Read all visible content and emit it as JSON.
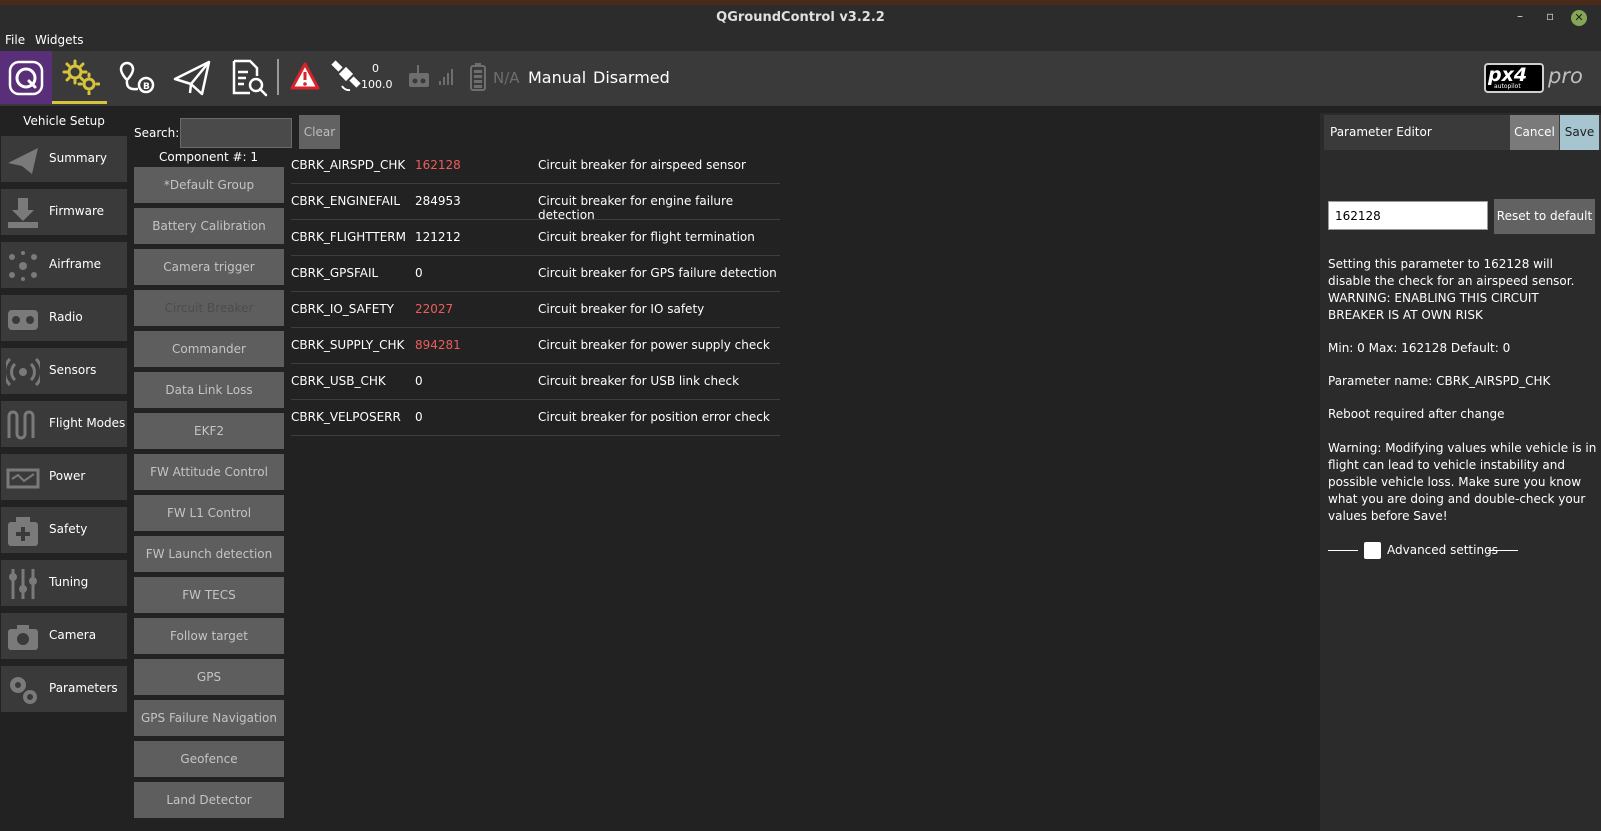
{
  "window": {
    "title": "QGroundControl v3.2.2",
    "minimize": "–",
    "restore": "▫",
    "close": "✕"
  },
  "menu": {
    "file": "File",
    "widgets": "Widgets"
  },
  "toolbar": {
    "gps_count": "0",
    "gps_hdop": "100.0",
    "battery": "N/A",
    "flight_mode": "Manual",
    "arm_state": "Disarmed",
    "brand": "px4",
    "brand_sub": "autopilot",
    "brand_pro": "pro",
    "icons": [
      "qgc-logo-icon",
      "gears-icon",
      "plan-route-icon",
      "paper-plane-icon",
      "analyze-icon",
      "warning-icon",
      "gps-satellite-icon",
      "rc-transmitter-icon",
      "signal-bars-icon",
      "battery-icon"
    ],
    "colors": {
      "setup_underline": "#d8c43c",
      "logo_bg": "#5a2f7a",
      "warning": "#d9232a"
    }
  },
  "sidebar": {
    "header": "Vehicle Setup",
    "items": [
      {
        "label": "Summary",
        "icon": "paper-plane-icon"
      },
      {
        "label": "Firmware",
        "icon": "download-icon"
      },
      {
        "label": "Airframe",
        "icon": "airframe-icon"
      },
      {
        "label": "Radio",
        "icon": "rc-transmitter-icon"
      },
      {
        "label": "Sensors",
        "icon": "sensors-icon"
      },
      {
        "label": "Flight Modes",
        "icon": "flight-modes-icon"
      },
      {
        "label": "Power",
        "icon": "battery-icon"
      },
      {
        "label": "Safety",
        "icon": "first-aid-icon"
      },
      {
        "label": "Tuning",
        "icon": "sliders-icon"
      },
      {
        "label": "Camera",
        "icon": "camera-icon"
      },
      {
        "label": "Parameters",
        "icon": "gears-icon"
      }
    ]
  },
  "search": {
    "label": "Search:",
    "value": "",
    "clear_label": "Clear"
  },
  "component_label": "Component #: 1",
  "groups": [
    "*Default Group",
    "Battery Calibration",
    "Camera trigger",
    "Circuit Breaker",
    "Commander",
    "Data Link Loss",
    "EKF2",
    "FW Attitude Control",
    "FW L1 Control",
    "FW Launch detection",
    "FW TECS",
    "Follow target",
    "GPS",
    "GPS Failure Navigation",
    "Geofence",
    "Land Detector"
  ],
  "selected_group": "Circuit Breaker",
  "params": [
    {
      "name": "CBRK_AIRSPD_CHK",
      "value": "162128",
      "non_default": true,
      "desc": "Circuit breaker for airspeed sensor"
    },
    {
      "name": "CBRK_ENGINEFAIL",
      "value": "284953",
      "non_default": false,
      "desc": "Circuit breaker for engine failure detection"
    },
    {
      "name": "CBRK_FLIGHTTERM",
      "value": "121212",
      "non_default": false,
      "desc": "Circuit breaker for flight termination"
    },
    {
      "name": "CBRK_GPSFAIL",
      "value": "0",
      "non_default": false,
      "desc": "Circuit breaker for GPS failure detection"
    },
    {
      "name": "CBRK_IO_SAFETY",
      "value": "22027",
      "non_default": true,
      "desc": "Circuit breaker for IO safety"
    },
    {
      "name": "CBRK_SUPPLY_CHK",
      "value": "894281",
      "non_default": true,
      "desc": "Circuit breaker for power supply check"
    },
    {
      "name": "CBRK_USB_CHK",
      "value": "0",
      "non_default": false,
      "desc": "Circuit breaker for USB link check"
    },
    {
      "name": "CBRK_VELPOSERR",
      "value": "0",
      "non_default": false,
      "desc": "Circuit breaker for position error check"
    }
  ],
  "editor": {
    "title": "Parameter Editor",
    "cancel_label": "Cancel",
    "save_label": "Save",
    "value": "162128",
    "reset_label": "Reset to default",
    "description": "Setting this parameter to 162128 will disable the check for an airspeed sensor. WARNING: ENABLING THIS CIRCUIT BREAKER IS AT OWN RISK",
    "range": "Min: 0  Max: 162128  Default: 0",
    "param_name": "Parameter name: CBRK_AIRSPD_CHK",
    "reboot": "Reboot required after change",
    "warning": "Warning: Modifying values while vehicle is in flight can lead to vehicle instability and possible vehicle loss. Make sure you know what you are doing and double-check your values before Save!",
    "advanced_label": "Advanced settings",
    "advanced_checked": false
  }
}
